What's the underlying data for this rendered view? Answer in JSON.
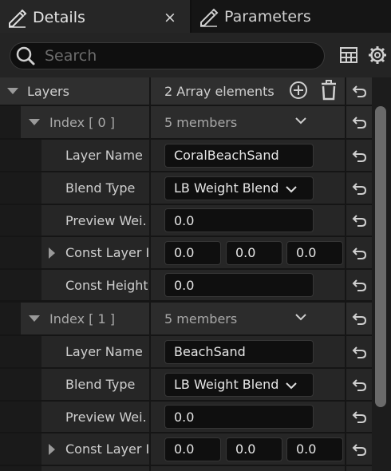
{
  "tabs": [
    {
      "label": "Details",
      "icon": "pencil-icon",
      "active": true,
      "closable": true,
      "close_glyph": "×"
    },
    {
      "label": "Parameters",
      "icon": "pencil-icon",
      "active": false
    }
  ],
  "search": {
    "placeholder": "Search",
    "value": ""
  },
  "toolbar_icons": [
    "table-view-icon",
    "settings-gear-icon"
  ],
  "category": {
    "label": "Layers",
    "value": "2 Array elements"
  },
  "layers": [
    {
      "index_label": "Index [ 0 ]",
      "members": "5 members",
      "layer_name_label": "Layer Name",
      "layer_name": "CoralBeachSand",
      "blend_type_label": "Blend Type",
      "blend_type": "LB Weight Blend",
      "preview_label": "Preview Wei…",
      "preview_value": "0.0",
      "const_layer_label": "Const Layer I…",
      "const_layer": [
        "0.0",
        "0.0",
        "0.0"
      ],
      "const_height_label": "Const Height…",
      "const_height": "0.0"
    },
    {
      "index_label": "Index [ 1 ]",
      "members": "5 members",
      "layer_name_label": "Layer Name",
      "layer_name": "BeachSand",
      "blend_type_label": "Blend Type",
      "blend_type": "LB Weight Blend",
      "preview_label": "Preview Wei…",
      "preview_value": "0.0",
      "const_layer_label": "Const Layer I…",
      "const_layer": [
        "0.0",
        "0.0",
        "0.0"
      ]
    }
  ],
  "colors": {
    "panel": "#262626",
    "background": "#151515",
    "field": "#0f0f0f",
    "text": "#cfcfcf"
  }
}
